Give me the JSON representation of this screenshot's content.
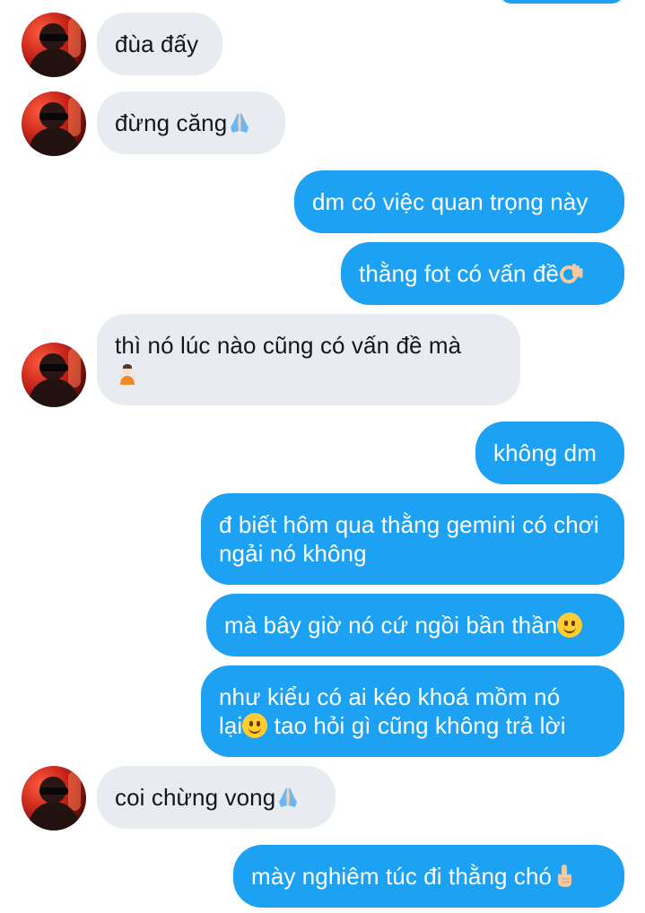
{
  "colors": {
    "incoming_bubble": "#e8ecf0",
    "outgoing_bubble": "#1da1f2",
    "incoming_text": "#14171a",
    "outgoing_text": "#ffffff"
  },
  "messages": [
    {
      "direction": "incoming",
      "text": "đùa đấy",
      "emoji": null
    },
    {
      "direction": "incoming",
      "text": "đừng căng",
      "emoji": "folded-hands"
    },
    {
      "direction": "outgoing",
      "text": "dm có việc quan trọng này",
      "emoji": null
    },
    {
      "direction": "outgoing",
      "text": "thằng fot có vấn đề",
      "emoji": "ok-hand"
    },
    {
      "direction": "incoming",
      "text": "thì nó lúc nào cũng có vấn đề mà",
      "emoji": "person-shrugging"
    },
    {
      "direction": "outgoing",
      "text": "không dm",
      "emoji": null
    },
    {
      "direction": "outgoing",
      "text": "đ biết hôm qua thằng gemini có chơi ngải nó không",
      "emoji": null
    },
    {
      "direction": "outgoing",
      "text": "mà bây giờ nó cứ ngồi bần thần",
      "emoji": "slightly-smiling-face"
    },
    {
      "direction": "outgoing",
      "text_line1": "như kiểu có ai kéo khoá mồm nó",
      "text_line2_before_emoji": "lại",
      "text_line2_after_emoji": " tao hỏi gì cũng không trả lời",
      "emoji": "slightly-smiling-face"
    },
    {
      "direction": "incoming",
      "text": "coi chừng vong",
      "emoji": "folded-hands"
    },
    {
      "direction": "outgoing",
      "text": "mày nghiêm túc đi thằng chó",
      "emoji": "index-pointing-up"
    }
  ]
}
